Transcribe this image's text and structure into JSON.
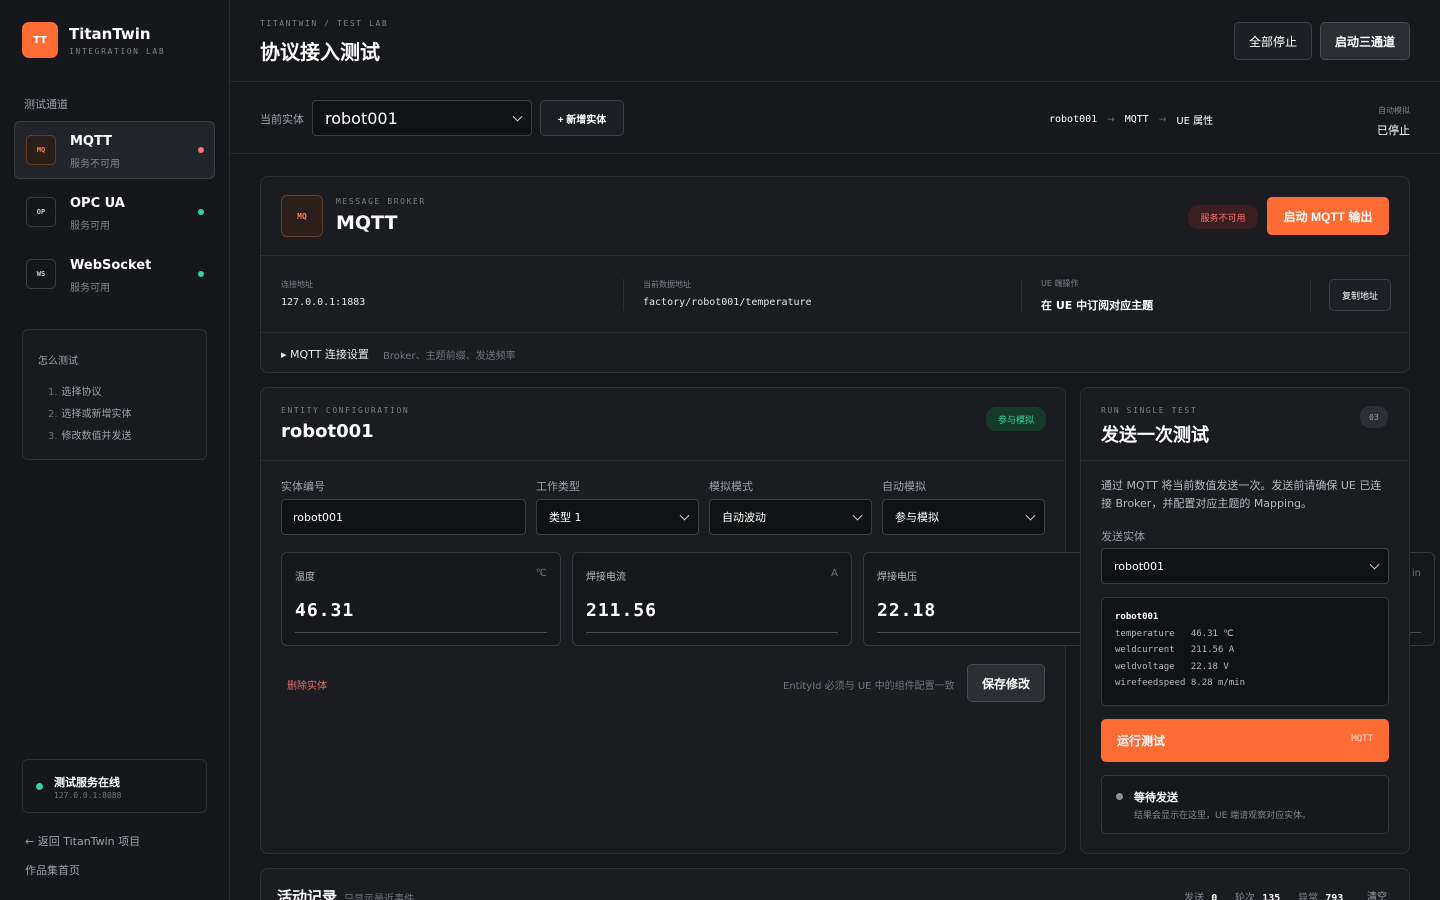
{
  "brand": {
    "logo": "TT",
    "name": "TitanTwin",
    "sub": "INTEGRATION LAB"
  },
  "sidebar": {
    "section_title": "测试通道",
    "channels": [
      {
        "code": "MQ",
        "name": "MQTT",
        "status": "服务不可用",
        "status_color": "#f87171"
      },
      {
        "code": "OP",
        "name": "OPC UA",
        "status": "服务可用",
        "status_color": "#34d399"
      },
      {
        "code": "WS",
        "name": "WebSocket",
        "status": "服务可用",
        "status_color": "#34d399"
      }
    ],
    "howto": {
      "title": "怎么测试",
      "steps": [
        {
          "n": "1.",
          "text": "选择协议"
        },
        {
          "n": "2.",
          "text": "选择或新增实体"
        },
        {
          "n": "3.",
          "text": "修改数值并发送"
        }
      ]
    },
    "service": {
      "name": "测试服务在线",
      "addr": "127.0.0.1:8088"
    },
    "back_link": "← 返回 TitanTwin 项目",
    "home_link": "作品集首页"
  },
  "header": {
    "breadcrumb": "TITANTWIN / TEST LAB",
    "title": "协议接入测试",
    "stop_all": "全部停止",
    "start_three": "启动三通道"
  },
  "entity_bar": {
    "label": "当前实体",
    "selected": "robot001",
    "add_button": "+ 新增实体",
    "flow": [
      "robot001",
      "MQTT",
      "UE 属性"
    ],
    "auto_label": "自动模拟",
    "auto_value": "已停止"
  },
  "broker": {
    "icon": "MQ",
    "kicker": "MESSAGE BROKER",
    "name": "MQTT",
    "status_badge": "服务不可用",
    "start_button": "启动 MQTT 输出",
    "conn_label": "连接地址",
    "conn_value": "127.0.0.1:1883",
    "topic_label": "当前数据地址",
    "topic_value": "factory/robot001/temperature",
    "ue_label": "UE 端操作",
    "ue_value": "在 UE 中订阅对应主题",
    "copy_button": "复制地址",
    "settings_toggle": "▸ MQTT 连接设置",
    "settings_hint": "Broker、主题前缀、发送频率"
  },
  "entity_config": {
    "kicker": "ENTITY CONFIGURATION",
    "title": "robot001",
    "badge": "参与模拟",
    "fields": {
      "id_label": "实体编号",
      "id_value": "robot001",
      "type_label": "工作类型",
      "type_value": "类型 1",
      "mode_label": "模拟模式",
      "mode_value": "自动波动",
      "auto_label": "自动模拟",
      "auto_value": "参与模拟"
    },
    "metrics": [
      {
        "label": "温度",
        "unit": "℃",
        "value": "46.31"
      },
      {
        "label": "焊接电流",
        "unit": "A",
        "value": "211.56"
      },
      {
        "label": "焊接电压",
        "unit": "",
        "value": "22.18"
      },
      {
        "label": "",
        "unit": "in",
        "value": ""
      }
    ],
    "delete_button": "删除实体",
    "hint": "EntityId 必须与 UE 中的组件配置一致",
    "save_button": "保存修改"
  },
  "single_test": {
    "kicker": "RUN SINGLE TEST",
    "title": "发送一次测试",
    "step_badge": "03",
    "description": "通过 MQTT 将当前数值发送一次。发送前请确保 UE 已连接 Broker，并配置对应主题的 Mapping。",
    "send_label": "发送实体",
    "send_value": "robot001",
    "preview": {
      "entity": "robot001",
      "rows": [
        "temperature   46.31 ℃",
        "weldcurrent   211.56 A",
        "weldvoltage   22.18 V",
        "wirefeedspeed 8.28 m/min"
      ]
    },
    "run_button": "运行测试",
    "run_tag": "MQTT",
    "result_title": "等待发送",
    "result_text": "结果会显示在这里，UE 端请观察对应实体。"
  },
  "activity": {
    "title": "活动记录",
    "subtitle": "只显示最近事件",
    "sent_label": "发送",
    "sent_value": "0",
    "round_label": "轮次",
    "round_value": "135",
    "error_label": "异常",
    "error_value": "793",
    "clear_button": "清空"
  },
  "colors": {
    "accent": "#ff6b35",
    "ok": "#34d399",
    "error": "#f87171"
  }
}
